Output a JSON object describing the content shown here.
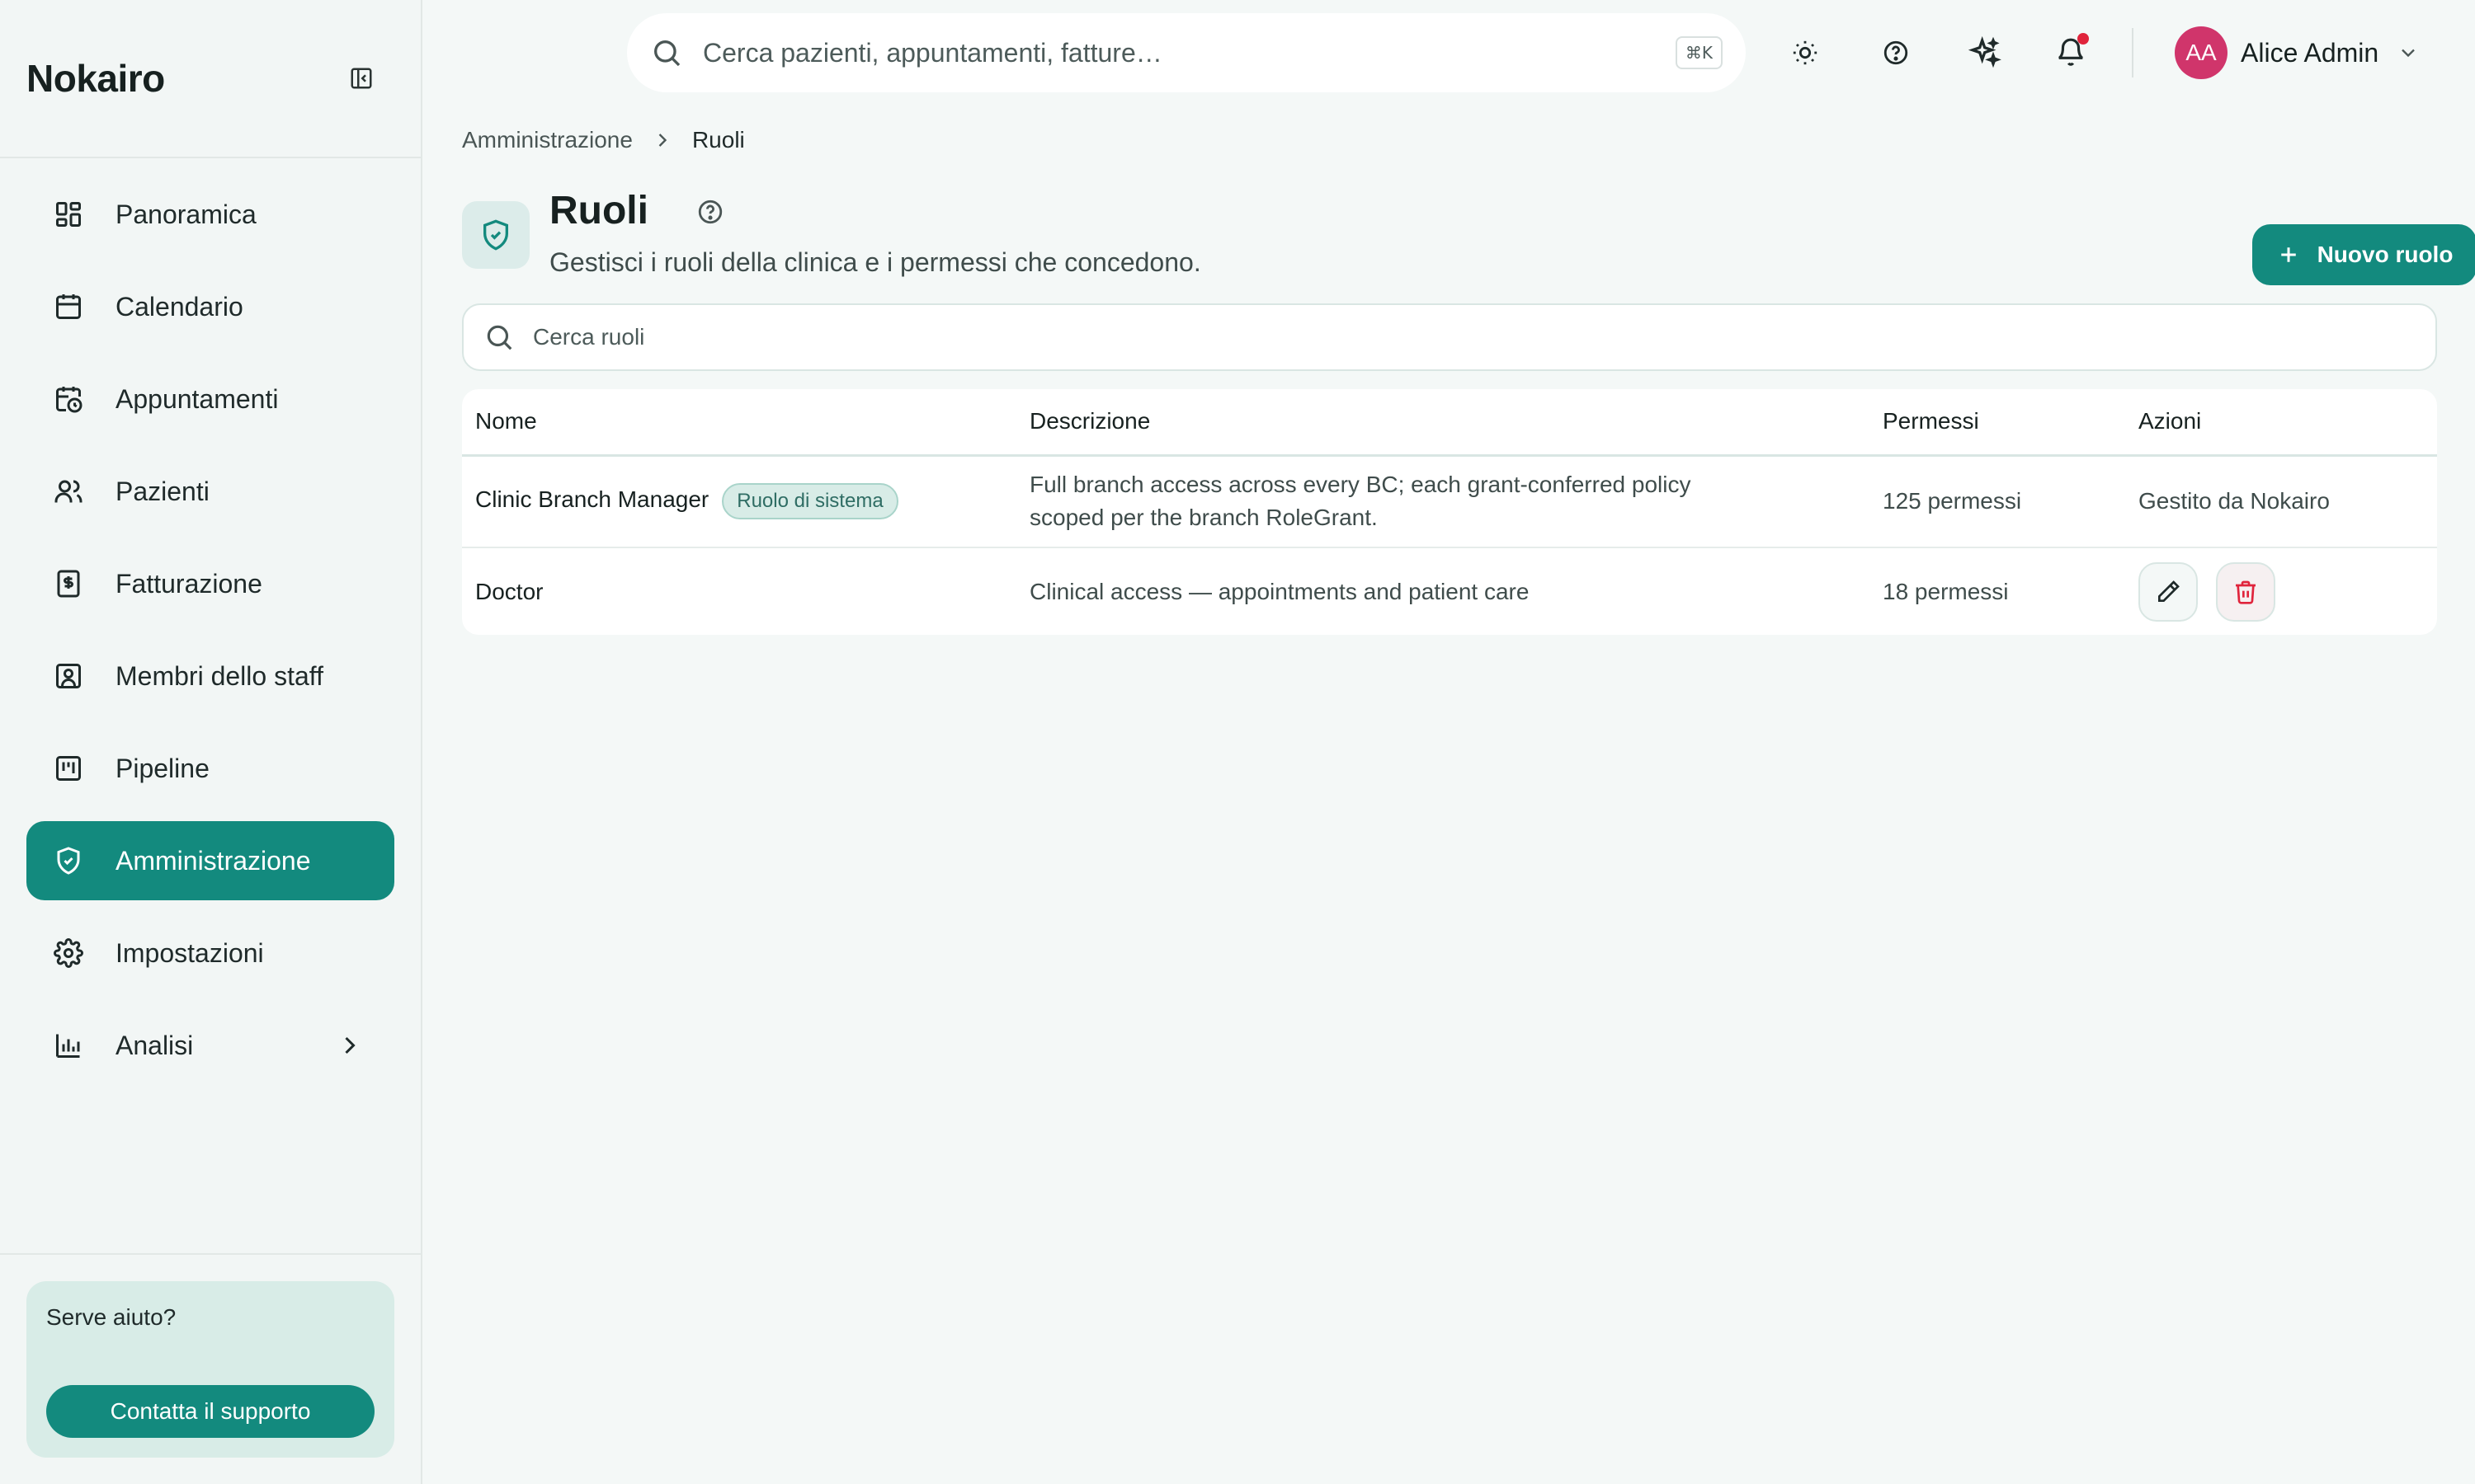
{
  "brand": {
    "name": "Nokairo"
  },
  "sidebar": {
    "items": [
      {
        "label": "Panoramica",
        "icon": "dashboard-icon"
      },
      {
        "label": "Calendario",
        "icon": "calendar-icon"
      },
      {
        "label": "Appuntamenti",
        "icon": "calendar-clock-icon"
      },
      {
        "label": "Pazienti",
        "icon": "users-icon"
      },
      {
        "label": "Fatturazione",
        "icon": "invoice-icon"
      },
      {
        "label": "Membri dello staff",
        "icon": "id-badge-icon"
      },
      {
        "label": "Pipeline",
        "icon": "kanban-icon"
      },
      {
        "label": "Amministrazione",
        "icon": "shield-icon",
        "active": true
      },
      {
        "label": "Impostazioni",
        "icon": "gear-icon"
      },
      {
        "label": "Analisi",
        "icon": "bar-chart-icon"
      }
    ],
    "help": {
      "title": "Serve aiuto?",
      "button": "Contatta il supporto"
    }
  },
  "header": {
    "search_placeholder": "Cerca pazienti, appuntamenti, fatture…",
    "shortcut": "⌘K",
    "user": {
      "initials": "AA",
      "name": "Alice Admin"
    }
  },
  "breadcrumb": {
    "parent": "Amministrazione",
    "current": "Ruoli"
  },
  "page": {
    "title": "Ruoli",
    "subtitle": "Gestisci i ruoli della clinica e i permessi che concedono.",
    "new_button": "Nuovo ruolo",
    "search_placeholder": "Cerca ruoli"
  },
  "table": {
    "columns": [
      "Nome",
      "Descrizione",
      "Permessi",
      "Azioni"
    ],
    "rows": [
      {
        "name": "Clinic Branch Manager",
        "badge": "Ruolo di sistema",
        "description_line1": "Full branch access across every BC; each grant-conferred policy",
        "description_line2": "scoped per the branch RoleGrant.",
        "permissions": "125 permessi",
        "actions": "Gestito da Nokairo"
      },
      {
        "name": "Doctor",
        "description": "Clinical access — appointments and patient care",
        "permissions": "18 permessi"
      }
    ]
  },
  "colors": {
    "accent": "#138a7e",
    "danger": "#e0243c",
    "avatar": "#d0356b"
  }
}
